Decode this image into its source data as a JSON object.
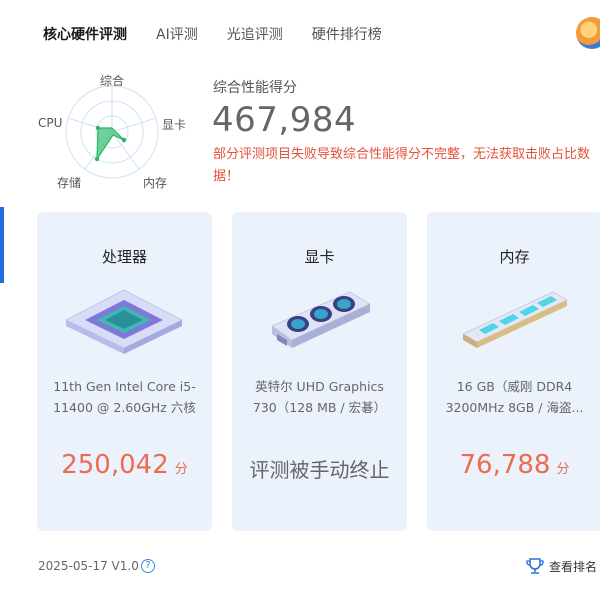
{
  "tabs": [
    {
      "label": "核心硬件评测",
      "active": true
    },
    {
      "label": "AI评测",
      "active": false
    },
    {
      "label": "光追评测",
      "active": false
    },
    {
      "label": "硬件排行榜",
      "active": false
    }
  ],
  "radar": {
    "labels": {
      "top": "综合",
      "left": "CPU",
      "right": "显卡",
      "bottom_left": "存储",
      "bottom_right": "内存"
    }
  },
  "score": {
    "title": "综合性能得分",
    "value": "467,984",
    "warning": "部分评测项目失败导致综合性能得分不完整，无法获取击败占比数据！"
  },
  "cards": [
    {
      "title": "处理器",
      "desc_line1": "11th Gen Intel Core i5-",
      "desc_line2": "11400 @ 2.60GHz 六核",
      "score": "250,042",
      "unit": "分"
    },
    {
      "title": "显卡",
      "desc_line1": "英特尔 UHD Graphics",
      "desc_line2": "730（128 MB / 宏碁）",
      "status": "评测被手动终止"
    },
    {
      "title": "内存",
      "desc_line1": "16 GB（威刚 DDR4",
      "desc_line2": "3200MHz 8GB / 海盗...",
      "score": "76,788",
      "unit": "分"
    }
  ],
  "footer": {
    "version": "2025-05-17 V1.0",
    "help_icon": "?",
    "rank_label": "查看排名"
  },
  "colors": {
    "accent": "#1f6fe0",
    "score_red": "#ef6b4f",
    "warning_red": "#e4513a",
    "card_bg": "#ebf2fc",
    "radar_fill": "#3ec47a"
  }
}
